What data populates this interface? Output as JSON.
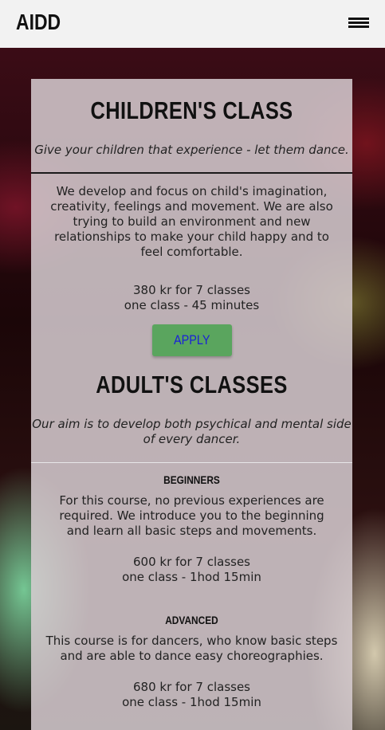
{
  "header": {
    "logo": "AIDD"
  },
  "children": {
    "title": "CHILDREN'S CLASS",
    "subtitle": "Give your children that experience - let them dance.",
    "description_lines": [
      "We develop and focus on child's imagination,",
      "creativity, feelings and movement. We are also",
      "trying to build an environment and new",
      "relationships to make your child happy and to",
      "feel comfortable."
    ],
    "price": "380 kr for 7 classes",
    "duration": "one class - 45 minutes",
    "apply_label": "APPLY"
  },
  "adults": {
    "title": "ADULT'S CLASSES",
    "subtitle_lines": [
      "Our aim is to develop both psychical and mental side",
      "of every dancer."
    ],
    "beginners": {
      "title": "BEGINNERS",
      "description_lines": [
        "For this course, no previous experiences are",
        "required. We introduce you to the beginning",
        "and learn all basic steps and movements."
      ],
      "price": "600 kr for 7 classes",
      "duration": "one class - 1hod 15min"
    },
    "advanced": {
      "title": "ADVANCED",
      "description_lines": [
        "This course is for dancers, who know basic steps",
        "and are able to dance easy choreographies."
      ],
      "price": "680 kr for 7 classes",
      "duration": "one class - 1hod 15min"
    }
  }
}
